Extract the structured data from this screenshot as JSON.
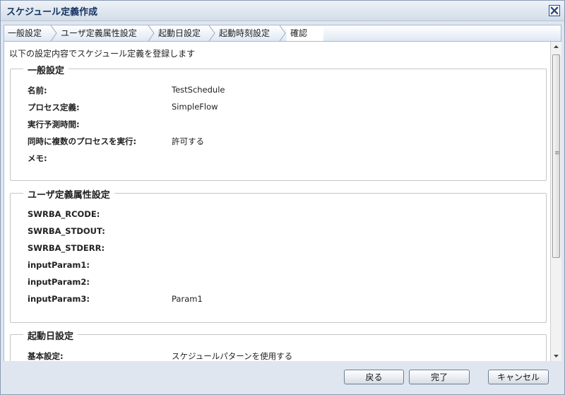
{
  "window": {
    "title": "スケジュール定義作成"
  },
  "steps": [
    {
      "label": "一般設定"
    },
    {
      "label": "ユーザ定義属性設定"
    },
    {
      "label": "起動日設定"
    },
    {
      "label": "起動時刻設定"
    },
    {
      "label": "確認"
    }
  ],
  "intro": "以下の設定内容でスケジュール定義を登録します",
  "sections": {
    "general": {
      "title": "一般設定",
      "rows": [
        {
          "label": "名前:",
          "value": "TestSchedule"
        },
        {
          "label": "プロセス定義:",
          "value": "SimpleFlow"
        },
        {
          "label": "実行予測時間:",
          "value": ""
        },
        {
          "label": "同時に複数のプロセスを実行:",
          "value": "許可する"
        },
        {
          "label": "メモ:",
          "value": ""
        }
      ]
    },
    "user_attrs": {
      "title": "ユーザ定義属性設定",
      "rows": [
        {
          "label": "SWRBA_RCODE:",
          "value": ""
        },
        {
          "label": "SWRBA_STDOUT:",
          "value": ""
        },
        {
          "label": "SWRBA_STDERR:",
          "value": ""
        },
        {
          "label": "inputParam1:",
          "value": ""
        },
        {
          "label": "inputParam2:",
          "value": ""
        },
        {
          "label": "inputParam3:",
          "value": "Param1"
        }
      ]
    },
    "start_date": {
      "title": "起動日設定",
      "rows": [
        {
          "label": "基本設定:",
          "value": "スケジュールパターンを使用する"
        }
      ]
    }
  },
  "buttons": {
    "back": "戻る",
    "finish": "完了",
    "cancel": "キャンセル"
  },
  "colors": {
    "accent": "#15325f",
    "close_icon": "#2b4c82",
    "panel_bg": "#dfe6ef"
  }
}
